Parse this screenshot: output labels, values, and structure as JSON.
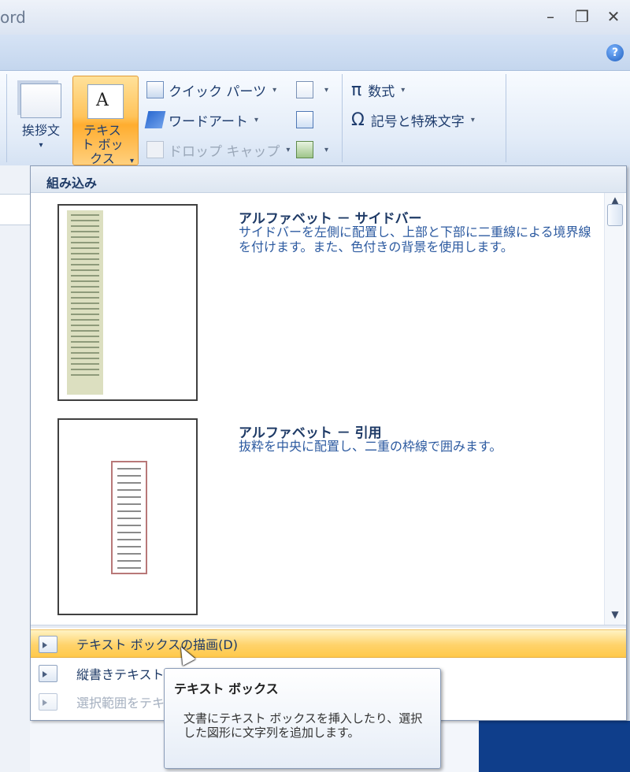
{
  "window": {
    "title": "ord",
    "minimize_icon": "minimize-icon",
    "restore_icon": "restore-icon",
    "close_icon": "close-icon"
  },
  "help": {
    "label": "?"
  },
  "ribbon": {
    "buttons": [
      {
        "label": "挨拶文",
        "icon": "greeting-icon"
      },
      {
        "label": "テキスト ボックス",
        "icon": "text-box-icon",
        "icon_glyph": "A",
        "active": true
      },
      {
        "label": "クイック パーツ",
        "icon": "quick-parts-icon"
      },
      {
        "label": "ワードアート",
        "icon": "wordart-icon"
      },
      {
        "label": "ドロップ キャップ",
        "icon": "drop-cap-icon",
        "disabled": true
      },
      {
        "label": "数式",
        "icon": "equation-icon",
        "glyph": "π"
      },
      {
        "label": "記号と特殊文字",
        "icon": "symbol-icon",
        "glyph": "Ω"
      }
    ]
  },
  "gallery": {
    "header": "組み込み",
    "items": [
      {
        "title": "アルファベット － サイドバー",
        "description": "サイドバーを左側に配置し、上部と下部に二重線による境界線を付けます。また、色付きの背景を使用します。"
      },
      {
        "title": "アルファベット － 引用",
        "description": "抜粋を中央に配置し、二重の枠線で囲みます。"
      }
    ],
    "commands": [
      {
        "label": "テキスト ボックスの描画(D)",
        "highlighted": true
      },
      {
        "label": "縦書きテキスト ボックスの描画(V)"
      },
      {
        "label": "選択範囲をテキスト ボックス ギャラリーに保存(S)",
        "disabled": true
      }
    ]
  },
  "tooltip": {
    "title": "テキスト ボックス",
    "body": "文書にテキスト ボックスを挿入したり、選択した図形に文字列を追加します。"
  },
  "colors": {
    "accent": "#ffc45c",
    "ribbon_blue": "#c4d6ee",
    "text_blue": "#1e3a66"
  }
}
